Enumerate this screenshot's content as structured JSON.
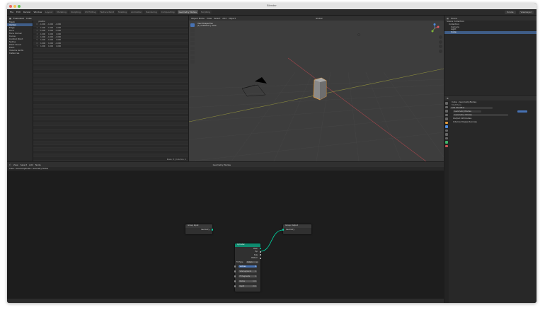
{
  "window": {
    "title": "Blender"
  },
  "menu": [
    "File",
    "Edit",
    "Render",
    "Window",
    "Help"
  ],
  "workspace_tabs": [
    "Layout",
    "Modeling",
    "Sculpting",
    "UV Editing",
    "Texture Paint",
    "Shading",
    "Animation",
    "Rendering",
    "Compositing",
    "Geometry Nodes",
    "Scripting"
  ],
  "workspace_active": "Geometry Nodes",
  "scene": {
    "scene_name": "Scene",
    "view_layer": "ViewLayer"
  },
  "spreadsheet": {
    "header_items": [
      "Evaluated",
      "Cube"
    ],
    "side_items": [
      {
        "label": "Mesh",
        "selected": false
      },
      {
        "label": "Vertex",
        "selected": true
      },
      {
        "label": "Edge",
        "selected": false
      },
      {
        "label": "Face",
        "selected": false
      },
      {
        "label": "Face Corner",
        "selected": false
      },
      {
        "label": "Curve",
        "selected": false
      },
      {
        "label": "Control Point",
        "selected": false
      },
      {
        "label": "Spline",
        "selected": false
      },
      {
        "label": "Point Cloud",
        "selected": false
      },
      {
        "label": "Point",
        "selected": false
      },
      {
        "label": "Volume Grids",
        "selected": false
      },
      {
        "label": "Instances",
        "selected": false
      }
    ],
    "columns": [
      "",
      "position",
      "",
      ""
    ],
    "rows": [
      [
        "0",
        "-1.000",
        "-1.000",
        "-1.000"
      ],
      [
        "1",
        "-1.000",
        "-1.000",
        "1.000"
      ],
      [
        "2",
        "-1.000",
        "1.000",
        "-1.000"
      ],
      [
        "3",
        "-1.000",
        "1.000",
        "1.000"
      ],
      [
        "4",
        "1.000",
        "-1.000",
        "-1.000"
      ],
      [
        "5",
        "1.000",
        "-1.000",
        "1.000"
      ],
      [
        "6",
        "1.000",
        "1.000",
        "-1.000"
      ],
      [
        "7",
        "1.000",
        "1.000",
        "1.000"
      ]
    ],
    "footer": "Rows: 8 | Columns: 1"
  },
  "viewport": {
    "header_items": [
      "Object Mode",
      "View",
      "Select",
      "Add",
      "Object"
    ],
    "info_lines": [
      "User Perspective",
      "(1) Collection | Cube"
    ],
    "orientation": "Global"
  },
  "outliner": {
    "header": "Scene",
    "rows": [
      {
        "label": "Scene Collection",
        "selected": false
      },
      {
        "label": "Collection",
        "selected": false
      },
      {
        "label": "Camera",
        "selected": false
      },
      {
        "label": "Light",
        "selected": false
      },
      {
        "label": "Cube",
        "selected": true
      }
    ]
  },
  "properties": {
    "breadcrumb": [
      "Cube",
      "GeometryNodes"
    ],
    "section": "Modifiers",
    "add_modifier": "Add Modifier",
    "modifier_name": "GeometryNodes",
    "node_group": "Geometry Nodes",
    "panels": [
      "Output Attributes",
      "Internal Dependencies"
    ]
  },
  "node_editor": {
    "header_items": [
      "View",
      "Select",
      "Add",
      "Node"
    ],
    "tree_name": "Geometry Nodes",
    "breadcrumb": [
      "Cube",
      "GeometryNodes",
      "Geometry Nodes"
    ],
    "nodes": {
      "group_input": {
        "title": "Group Input",
        "output": "Geometry"
      },
      "group_output": {
        "title": "Group Output",
        "input": "Geometry"
      },
      "cylinder": {
        "title": "Cylinder",
        "outputs": [
          "Mesh",
          "Top",
          "Side",
          "Bottom"
        ],
        "fill_type_label": "Fill Type",
        "fill_type_value": "N-Gon",
        "fields": [
          {
            "label": "Vertices",
            "value": "6"
          },
          {
            "label": "Side Segments",
            "value": "1"
          },
          {
            "label": "Fill Segments",
            "value": "1"
          },
          {
            "label": "Radius",
            "value": "1 m"
          },
          {
            "label": "Depth",
            "value": "2 m"
          }
        ]
      }
    }
  },
  "colors": {
    "accent": "#4772b3",
    "geometry_socket": "#00d6a3",
    "geometry_node_header": "#0e8b6f",
    "selection_outline": "#f2a03a"
  }
}
